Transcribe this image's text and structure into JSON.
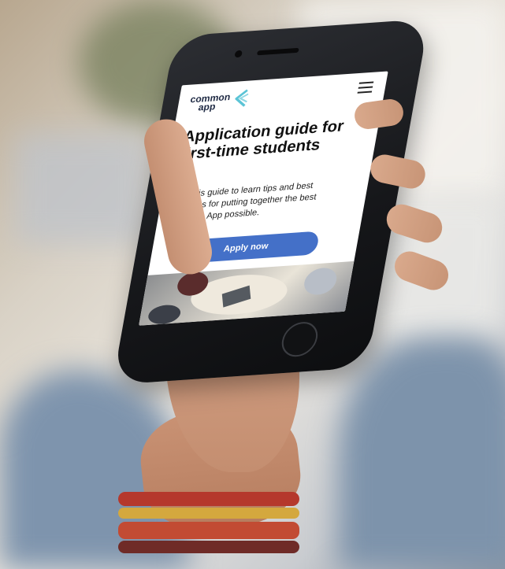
{
  "header": {
    "logo_line1": "common",
    "logo_line2": "app",
    "brand_accent": "#5bc4d6"
  },
  "main": {
    "headline": "Application guide for first-time students",
    "body": "Use this guide to learn tips and best practices for putting together the best Common App possible.",
    "apply_button_label": "Apply now",
    "button_color": "#4470c8"
  },
  "icons": {
    "menu": "hamburger-menu-icon",
    "logo": "common-app-logo-icon"
  }
}
